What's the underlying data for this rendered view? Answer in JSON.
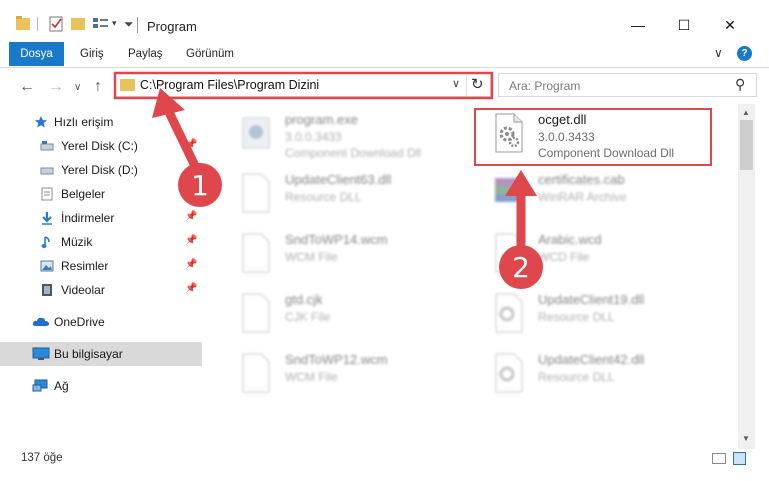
{
  "window": {
    "title": "Program",
    "controls": {
      "minimize": "—",
      "maximize": "☐",
      "close": "✕"
    }
  },
  "ribbon": {
    "tabs": [
      {
        "label": "Dosya",
        "active": true
      },
      {
        "label": "Giriş"
      },
      {
        "label": "Paylaş"
      },
      {
        "label": "Görünüm"
      }
    ],
    "help": "?",
    "expand": "∨"
  },
  "nav": {
    "back": "←",
    "forward": "→",
    "recent": "∨",
    "up": "↑",
    "address": "C:\\Program Files\\Program Dizini",
    "address_dropdown": "∨",
    "refresh": "↻",
    "search_placeholder": "Ara: Program",
    "search_icon": "⚲"
  },
  "sidebar": {
    "items": [
      {
        "label": "Hızlı erişim",
        "icon": "star-icon",
        "color": "#2b79d4"
      },
      {
        "label": "Yerel Disk (C:)",
        "icon": "drive-icon",
        "color": "#6f8da8",
        "pinned": true
      },
      {
        "label": "Yerel Disk (D:)",
        "icon": "drive-icon",
        "color": "#6f8da8"
      },
      {
        "label": "Belgeler",
        "icon": "documents-icon",
        "color": "#8c8c8c"
      },
      {
        "label": "İndirmeler",
        "icon": "download-icon",
        "color": "#2b79d4",
        "pinned": true
      },
      {
        "label": "Müzik",
        "icon": "music-icon",
        "color": "#2b79d4",
        "pinned": true
      },
      {
        "label": "Resimler",
        "icon": "pictures-icon",
        "color": "#4a7aa8",
        "pinned": true
      },
      {
        "label": "Videolar",
        "icon": "videos-icon",
        "color": "#555555",
        "pinned": true
      },
      {
        "label": "OneDrive",
        "icon": "cloud-icon",
        "color": "#1f6fd0"
      },
      {
        "label": "Bu bilgisayar",
        "icon": "computer-icon",
        "color": "#2b88d8",
        "selected": true
      },
      {
        "label": "Ağ",
        "icon": "network-icon",
        "color": "#2b88d8"
      }
    ],
    "pin_glyph": "📌"
  },
  "files": [
    {
      "name": "program.exe",
      "line2": "3.0.0.3433",
      "line3": "Component Download Dll",
      "col": 0,
      "row": 0
    },
    {
      "name": "ocget.dll",
      "line2": "3.0.0.3433",
      "line3": "Component Download Dll",
      "col": 1,
      "row": 0,
      "highlight": true
    },
    {
      "name": "UpdateClient63.dll",
      "line2": "Resource DLL",
      "col": 0,
      "row": 1
    },
    {
      "name": "certificates.cab",
      "line2": "WinRAR Archive",
      "col": 1,
      "row": 1
    },
    {
      "name": "SndToWP14.wcm",
      "line2": "WCM File",
      "col": 0,
      "row": 2
    },
    {
      "name": "Arabic.wcd",
      "line2": "WCD File",
      "col": 1,
      "row": 2
    },
    {
      "name": "gtd.cjk",
      "line2": "CJK File",
      "col": 0,
      "row": 3
    },
    {
      "name": "UpdateClient19.dll",
      "line2": "Resource DLL",
      "col": 1,
      "row": 3
    },
    {
      "name": "SndToWP12.wcm",
      "line2": "WCM File",
      "col": 0,
      "row": 4
    },
    {
      "name": "UpdateClient42.dll",
      "line2": "Resource DLL",
      "col": 1,
      "row": 4
    }
  ],
  "status": {
    "count": "137 öğe"
  },
  "annotations": {
    "step1": "1",
    "step2": "2",
    "color": "#e0474c"
  }
}
